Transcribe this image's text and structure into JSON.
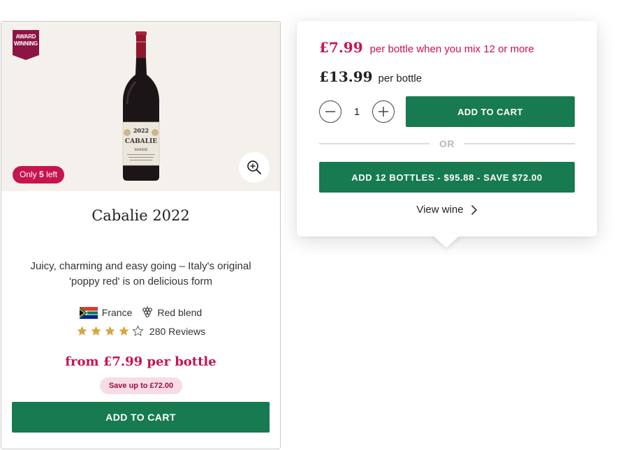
{
  "card": {
    "award_badge": "AWARD WINNING",
    "stock_prefix": "Only",
    "stock_count": "5",
    "stock_suffix": "left",
    "title": "Cabalie 2022",
    "description": "Juicy, charming and easy going – Italy's original 'poppy red' is on delicious form",
    "country": "France",
    "wine_type": "Red blend",
    "rating": 4,
    "rating_max": 5,
    "reviews": "280 Reviews",
    "price_from": "from £7.99 per bottle",
    "save_badge": "Save up to £72.00",
    "add_button": "ADD TO CART",
    "bottle_label": {
      "year": "2022",
      "name": "CABALIE",
      "numeral": "MMXXI"
    },
    "icons": {
      "zoom": "zoom-in-icon",
      "flag": "south-africa-flag-icon",
      "grape": "grape-icon",
      "star": "star-icon"
    }
  },
  "popover": {
    "mix_price": "£7.99",
    "mix_text": "per bottle when you mix 12 or more",
    "single_price": "£13.99",
    "single_text": "per bottle",
    "quantity": "1",
    "add_button": "ADD TO CART",
    "or_label": "OR",
    "bulk_button": "ADD 12 BOTTLES - $95.88 - SAVE $72.00",
    "view_link": "View wine",
    "icons": {
      "minus": "minus-icon",
      "plus": "plus-icon",
      "chevron": "chevron-right-icon"
    }
  },
  "colors": {
    "brand_green": "#177a51",
    "accent_pink": "#c8134f",
    "save_pill_bg": "#f7dce5",
    "hero_bg": "#f4f1ec",
    "star_gold": "#d9a441",
    "award_maroon": "#8d1543"
  }
}
